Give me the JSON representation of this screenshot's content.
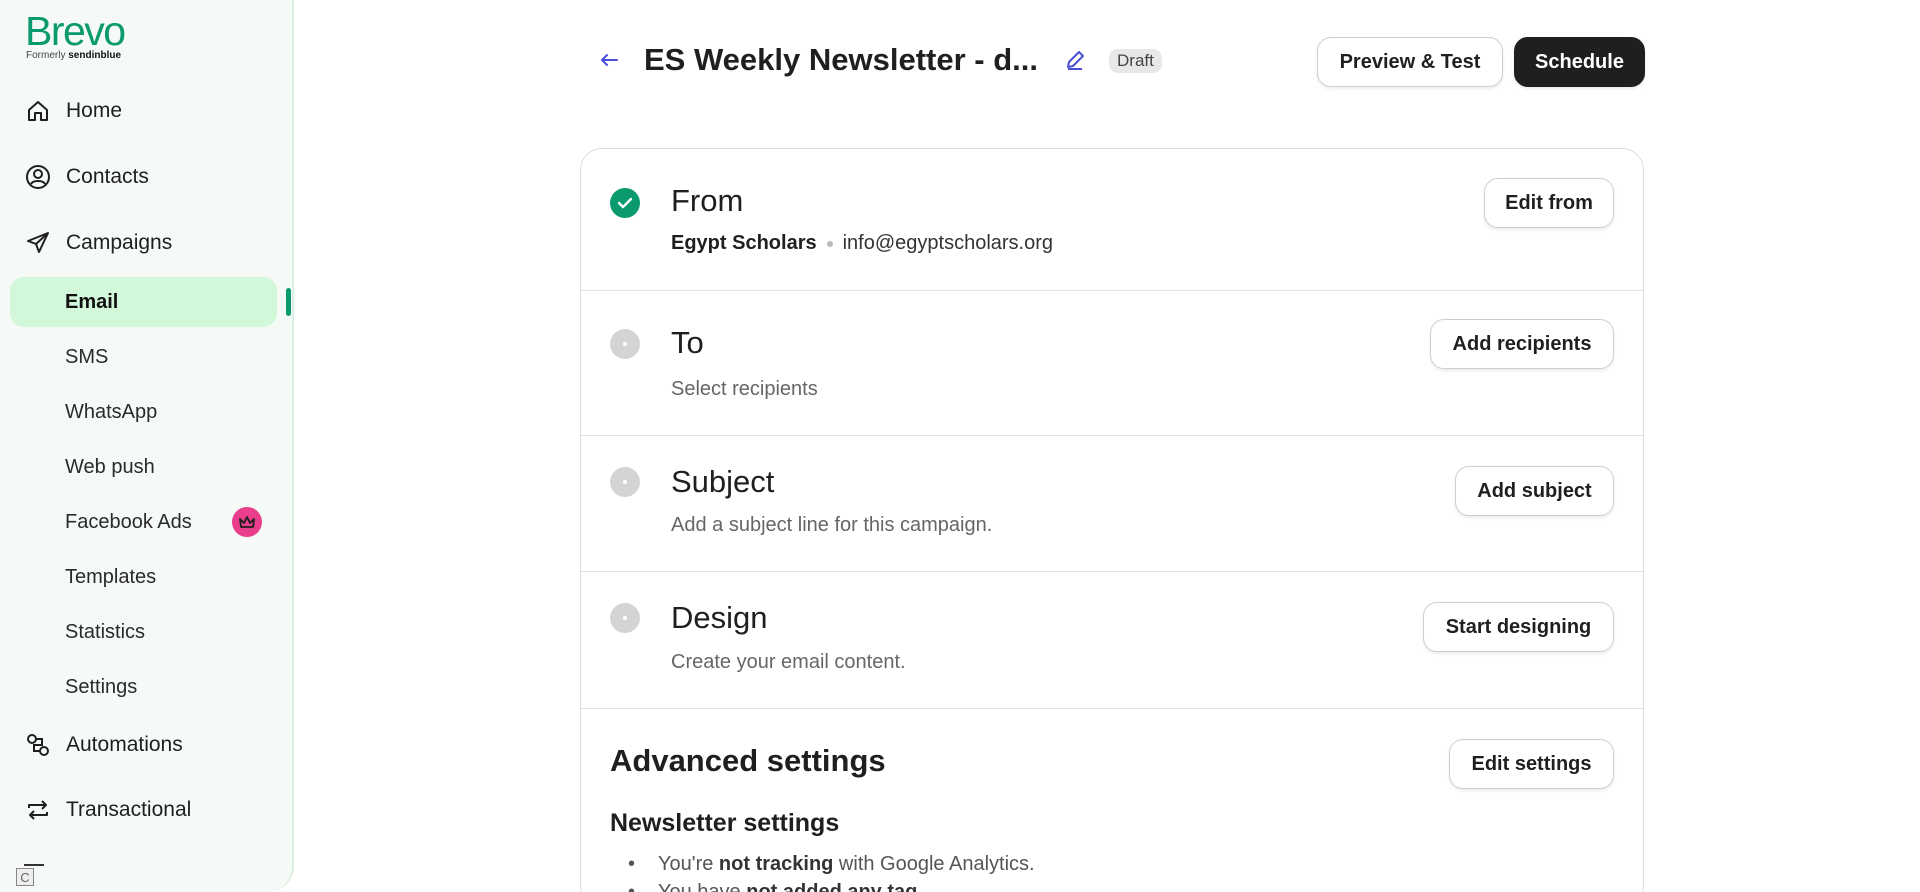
{
  "brand": {
    "name": "Brevo",
    "formerly": "Formerly",
    "formerly_name": "sendinblue",
    "color": "#0b996e"
  },
  "sidebar": {
    "main": [
      {
        "label": "Home",
        "icon": "home-icon"
      },
      {
        "label": "Contacts",
        "icon": "contacts-icon"
      },
      {
        "label": "Campaigns",
        "icon": "send-icon"
      }
    ],
    "campaigns_sub": [
      {
        "label": "Email",
        "active": true
      },
      {
        "label": "SMS"
      },
      {
        "label": "WhatsApp"
      },
      {
        "label": "Web push"
      },
      {
        "label": "Facebook Ads",
        "badge": "crown-icon"
      },
      {
        "label": "Templates"
      },
      {
        "label": "Statistics"
      },
      {
        "label": "Settings"
      }
    ],
    "bottom": [
      {
        "label": "Automations",
        "icon": "automations-icon"
      },
      {
        "label": "Transactional",
        "icon": "transactional-icon"
      }
    ]
  },
  "header": {
    "title": "ES Weekly Newsletter - d...",
    "status": "Draft",
    "preview_label": "Preview & Test",
    "schedule_label": "Schedule"
  },
  "sections": {
    "from": {
      "title": "From",
      "sender": "Egypt Scholars",
      "email": "info@egyptscholars.org",
      "action": "Edit from",
      "done": true
    },
    "to": {
      "title": "To",
      "desc": "Select recipients",
      "action": "Add recipients",
      "done": false
    },
    "subject": {
      "title": "Subject",
      "desc": "Add a subject line for this campaign.",
      "action": "Add subject",
      "done": false
    },
    "design": {
      "title": "Design",
      "desc": "Create your email content.",
      "action": "Start designing",
      "done": false
    },
    "advanced": {
      "title": "Advanced settings",
      "action": "Edit settings",
      "newsletter_title": "Newsletter settings",
      "bullets": [
        {
          "pre": "You're ",
          "strong": "not tracking",
          "post": " with Google Analytics."
        },
        {
          "pre": "You have ",
          "strong": "not added any tag",
          "post": "."
        }
      ]
    }
  }
}
